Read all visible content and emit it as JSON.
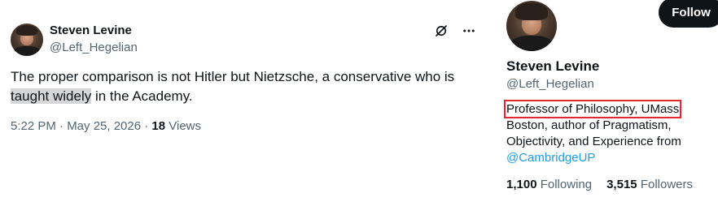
{
  "tweet": {
    "author_name": "Steven Levine",
    "author_handle": "@Left_Hegelian",
    "text_before": "The proper comparison is not Hitler but Nietzsche, a conservative who is",
    "text_highlight": "taught widely",
    "text_after": " in the Academy.",
    "timestamp": "5:22 PM · May 25, 2026 · ",
    "views_count": "18",
    "views_label": " Views",
    "icons": [
      "grok-icon",
      "more-icon"
    ]
  },
  "profile": {
    "follow_label": "Follow",
    "name": "Steven Levine",
    "handle": "@Left_Hegelian",
    "bio_highlight": "Professor of Philosophy, UMass",
    "bio_rest_1": "Boston, author of Pragmatism,",
    "bio_rest_2": "Objectivity, and Experience from",
    "bio_link": "@CambridgeUP",
    "following_count": "1,100",
    "following_label": "Following",
    "followers_count": "3,515",
    "followers_label": "Followers"
  },
  "colors": {
    "text": "#0f1419",
    "secondary": "#536471",
    "link": "#1d9bf0",
    "highlight_box": "#e0282e",
    "text_highlight_bg": "#d6d6d6"
  }
}
